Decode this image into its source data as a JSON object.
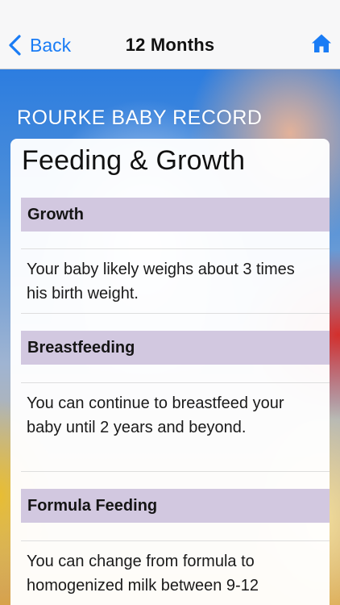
{
  "nav": {
    "back_label": "Back",
    "title": "12 Months",
    "back_icon": "chevron-left-icon",
    "home_icon": "home-icon",
    "accent_color": "#1a7cf5"
  },
  "brand": {
    "title": "ROURKE BABY RECORD"
  },
  "page": {
    "heading": "Feeding & Growth",
    "section_color": "#d2c8e0",
    "sections": [
      {
        "header": "Growth",
        "body": "Your baby likely weighs about 3 times his birth weight."
      },
      {
        "header": "Breastfeeding",
        "body": "You can continue to breastfeed your baby until 2 years and beyond."
      },
      {
        "header": "Formula Feeding",
        "body": "You can change from formula to homogenized milk between 9-12"
      }
    ]
  }
}
